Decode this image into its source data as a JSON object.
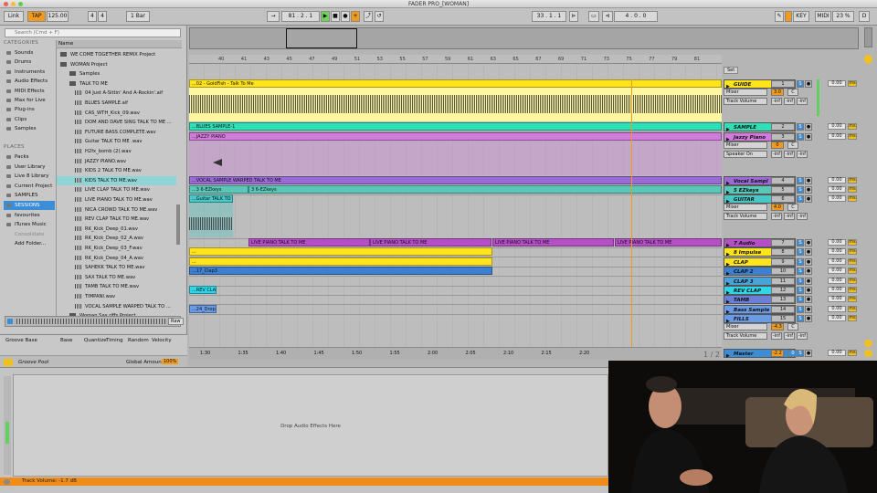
{
  "window": {
    "title": "FADER PRO_[WOMAN]"
  },
  "transport": {
    "link": "Link",
    "tap": "TAP",
    "tempo": "125.00",
    "sig_num": "4",
    "sig_den": "4",
    "quant": "1 Bar",
    "position": "81 . 2 . 1",
    "loop_start": "33 . 1 . 1",
    "loop_len": "4 . 0 . 0",
    "key": "KEY",
    "midi": "MIDI",
    "cpu": "23 %",
    "disk": "D"
  },
  "browser": {
    "search_placeholder": "Search (Cmd + F)",
    "categories_label": "CATEGORIES",
    "categories": [
      "Sounds",
      "Drums",
      "Instruments",
      "Audio Effects",
      "MIDI Effects",
      "Max for Live",
      "Plug-ins",
      "Clips",
      "Samples"
    ],
    "places_label": "PLACES",
    "places": [
      "Packs",
      "User Library",
      "Live 8 Library",
      "Current Project",
      "SAMPLES",
      "SESSIONS",
      "favourites",
      "iTunes Music",
      "Consolidate",
      "Add Folder..."
    ],
    "name_header": "Name",
    "files": [
      "WE COME TOGETHER REMIX Project",
      "WOMAN Project",
      "Samples",
      "TALK TO ME",
      "04 Just A-Sittin' And A-Rockin'.aif",
      "BLUES SAMPLE.aif",
      "CAS_WTH_Kick_09.wav",
      "DOM AND DAVE SING TALK TO ME ...",
      "FUTURE BASS COMPLETE.wav",
      "Guitar TALK TO ME .wav",
      "H2fx_bomb (2).wav",
      "JAZZY PIANO.wav",
      "KIDS 2 TALK TO ME.wav",
      "KIDS TALK TO ME.wav",
      "LIVE CLAP TALK TO ME.wav",
      "LIVE PIANO TALK TO ME.wav",
      "NICA CROWD TALK TO ME.wav",
      "REV CLAP TALK TO ME.wav",
      "RK_Kick_Deep_01.wav",
      "RK_Kick_Deep_02_A.wav",
      "RK_Kick_Deep_03_F.wav",
      "RK_Kick_Deep_04_A.wav",
      "SAHEKK TALK TO ME.wav",
      "SAX TALK TO ME.wav",
      "TAMB TALK TO ME.wav",
      "TIMPANI.wav",
      "VOCAL SAMPLE WARPED TALK TO ...",
      "Woman Sax riffs Project"
    ],
    "raw": "Raw"
  },
  "groove": {
    "headers": [
      "Groove Base",
      "Base",
      "Quantize",
      "Timing",
      "Random",
      "Velocity"
    ],
    "pool": "Groove Pool",
    "global_amount_label": "Global Amount",
    "global_amount": "100%"
  },
  "ruler": {
    "bars": [
      "40",
      "41",
      "43",
      "45",
      "47",
      "49",
      "51",
      "53",
      "55",
      "57",
      "59",
      "61",
      "63",
      "65",
      "67",
      "69",
      "71",
      "73",
      "75",
      "77",
      "79",
      "81"
    ],
    "times": [
      "1:30",
      "1:35",
      "1:40",
      "1:45",
      "1:50",
      "1:55",
      "2:00",
      "2:05",
      "2:10",
      "2:15",
      "2:20"
    ]
  },
  "clips": [
    {
      "label": "...02 - GoldFish - Talk To Me",
      "color": "#ffe41c"
    },
    {
      "label": "...BLUES SAMPLE-1",
      "color": "#2ee0b7"
    },
    {
      "label": "...JAZZY PIANO",
      "color": "#d27bdc"
    },
    {
      "label": "...VOCAL SAMPLE WARPED TALK TO ME",
      "color": "#9b6ad6"
    },
    {
      "label": "...3 6-EZkeys",
      "color": "#5ac8b8"
    },
    {
      "label": "3 6-EZkeys",
      "color": "#5ac8b8"
    },
    {
      "label": "...Guitar TALK TO M",
      "color": "#49c6c6"
    },
    {
      "label": "LIVE PIANO TALK TO ME",
      "color": "#b44fc6"
    },
    {
      "label": "...",
      "color": "#ffe41c"
    },
    {
      "label": "...17_Clap3",
      "color": "#3d7fd0"
    },
    {
      "label": "...REV CLAP",
      "color": "#2fd6e8"
    },
    {
      "label": "...24_DropS",
      "color": "#6a9be6"
    }
  ],
  "tracks": [
    {
      "name": "GUIDE",
      "color": "#ffe41c",
      "num": "1"
    },
    {
      "name": "SAMPLE",
      "color": "#2ee0b7",
      "num": "2"
    },
    {
      "name": "Jazzy Piano",
      "color": "#d27bdc",
      "num": "3"
    },
    {
      "name": "Vocal Sampl",
      "color": "#9b6ad6",
      "num": "4"
    },
    {
      "name": "5 EZkeys",
      "color": "#5ac8b8",
      "num": "5"
    },
    {
      "name": "GUITAR",
      "color": "#49c6c6",
      "num": "6"
    },
    {
      "name": "7 Audio",
      "color": "#b44fc6",
      "num": "7"
    },
    {
      "name": "8 Impulse",
      "color": "#ffe41c",
      "num": "8"
    },
    {
      "name": "CLAP",
      "color": "#ffe41c",
      "num": "9"
    },
    {
      "name": "CLAP 2",
      "color": "#3d7fd0",
      "num": "10"
    },
    {
      "name": "CLAP 3",
      "color": "#4aa3d8",
      "num": "11"
    },
    {
      "name": "REV CLAP",
      "color": "#2fd6e8",
      "num": "12"
    },
    {
      "name": "TAMB",
      "color": "#6a7fd8",
      "num": "13"
    },
    {
      "name": "Bass Sample",
      "color": "#6a9be6",
      "num": "14"
    },
    {
      "name": "FILLS",
      "color": "#6a9be6",
      "num": "15"
    },
    {
      "name": "Master",
      "color": "#3b8ed6",
      "num": ""
    }
  ],
  "mixer_labels": {
    "mixer": "Mixer",
    "track_volume": "Track Volume",
    "speaker_on": "Speaker On",
    "inf": "-inf",
    "s": "S",
    "c": "C",
    "vol": "0.00",
    "ms": "ms",
    "set": "Set"
  },
  "track_values": {
    "guide_pan": "3.0",
    "jazzy_pan": "0",
    "guitar_pan": "4.0",
    "fills_pan": "-4.3",
    "master_vol": "-2.2",
    "master_pan": "0"
  },
  "page_fraction": "1 / 2",
  "bottom": {
    "drop": "Drop Audio Effects Here",
    "status": "Track Volume: -1.7 dB"
  }
}
